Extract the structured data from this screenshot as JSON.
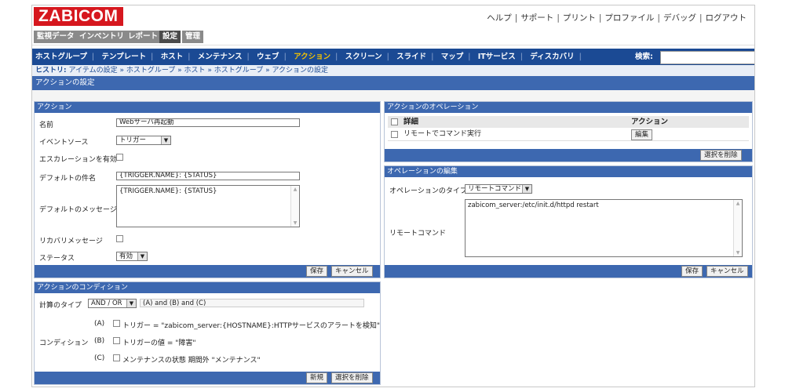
{
  "app": {
    "logo": "ZABICOM"
  },
  "top_links": [
    "ヘルプ",
    "サポート",
    "プリント",
    "プロファイル",
    "デバッグ",
    "ログアウト"
  ],
  "menu_tabs": [
    {
      "label": "監視データ",
      "active": false
    },
    {
      "label": "インベントリ",
      "active": false
    },
    {
      "label": "レポート",
      "active": false
    },
    {
      "label": "設定",
      "active": true
    },
    {
      "label": "管理",
      "active": false
    }
  ],
  "subnav": {
    "items": [
      "ホストグループ",
      "テンプレート",
      "ホスト",
      "メンテナンス",
      "ウェブ",
      "アクション",
      "スクリーン",
      "スライド",
      "マップ",
      "ITサービス",
      "ディスカバリ"
    ],
    "selected": "アクション",
    "search_label": "検索:",
    "search_value": ""
  },
  "history": {
    "label": "ヒストリ:",
    "crumbs": [
      "アイテムの設定",
      "ホストグループ",
      "ホスト",
      "ホストグループ",
      "アクションの設定"
    ]
  },
  "page_title": "アクションの設定",
  "action_panel": {
    "header": "アクション",
    "name_label": "名前",
    "name_value": "Webサーバ再起動",
    "event_source_label": "イベントソース",
    "event_source_value": "トリガー",
    "escalation_label": "エスカレーションを有効",
    "default_subject_label": "デフォルトの件名",
    "default_subject_value": "{TRIGGER.NAME}: {STATUS}",
    "default_message_label": "デフォルトのメッセージ",
    "default_message_value": "{TRIGGER.NAME}: {STATUS}",
    "recovery_label": "リカバリメッセージ",
    "status_label": "ステータス",
    "status_value": "有効",
    "save_label": "保存",
    "cancel_label": "キャンセル"
  },
  "condition_panel": {
    "header": "アクションのコンディション",
    "calc_type_label": "計算のタイプ",
    "calc_type_value": "AND / OR",
    "calc_expression": "(A) and (B) and (C)",
    "conditions_label": "コンディション",
    "conditions": [
      {
        "id": "(A)",
        "text": "トリガー = \"zabicom_server:{HOSTNAME}:HTTPサービスのアラートを検知\""
      },
      {
        "id": "(B)",
        "text": "トリガーの値 = \"障害\""
      },
      {
        "id": "(C)",
        "text": "メンテナンスの状態 期間外 \"メンテナンス\""
      }
    ],
    "new_label": "新規",
    "delete_selected_label": "選択を削除"
  },
  "operations_panel": {
    "header": "アクションのオペレーション",
    "col_details": "詳細",
    "col_action": "アクション",
    "rows": [
      {
        "details": "リモートでコマンド実行",
        "action": "編集"
      }
    ],
    "delete_selected_label": "選択を削除"
  },
  "edit_operation_panel": {
    "header": "オペレーションの編集",
    "op_type_label": "オペレーションのタイプ",
    "op_type_value": "リモートコマンド",
    "remote_command_label": "リモートコマンド",
    "remote_command_value": "zabicom_server:/etc/init.d/httpd restart",
    "save_label": "保存",
    "cancel_label": "キャンセル"
  },
  "colors": {
    "brand_red": "#d6171e",
    "nav_blue": "#1b4a94",
    "header_blue": "#3d68b0",
    "selected_yellow": "#f5c300"
  }
}
